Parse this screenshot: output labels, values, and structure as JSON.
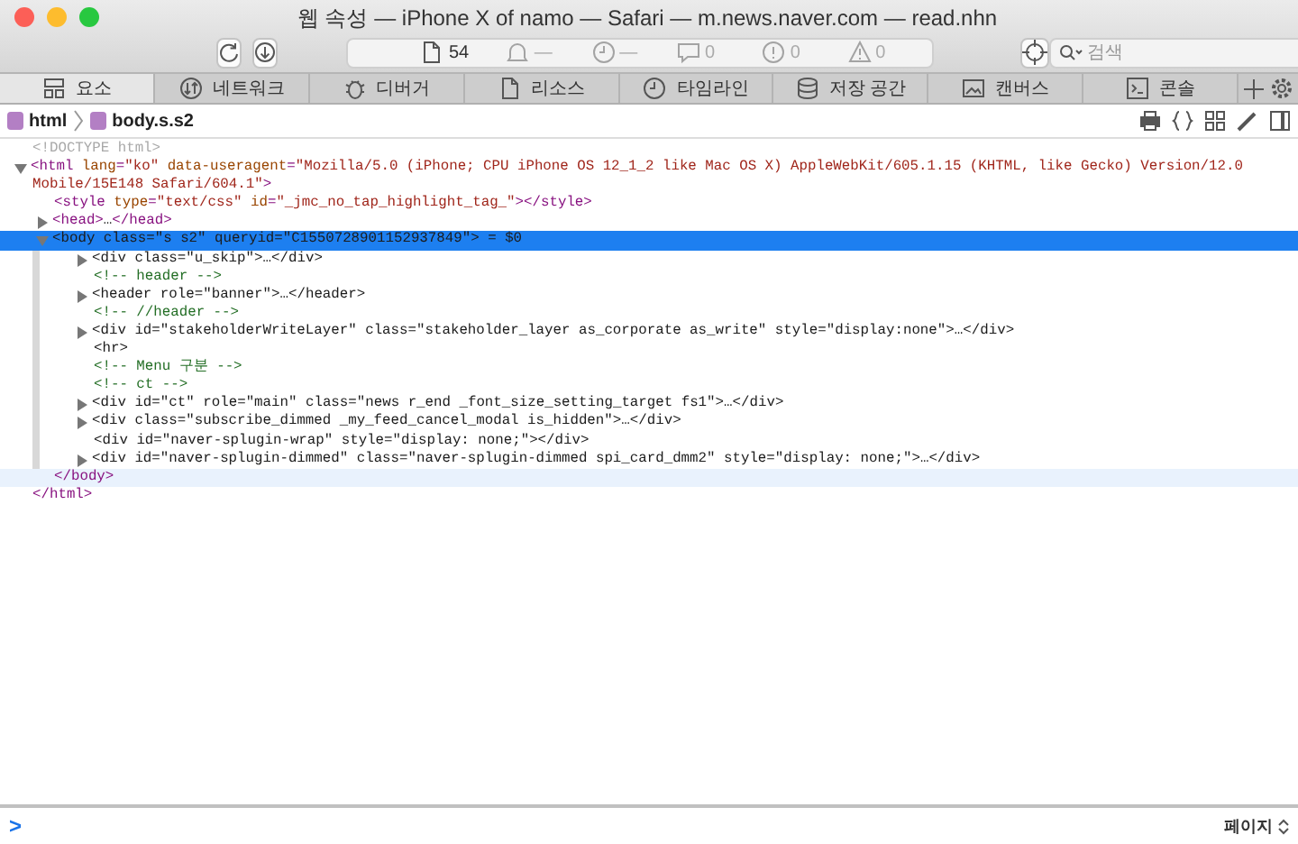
{
  "window": {
    "title": "웹 속성 — iPhone X of namo — Safari — m.news.naver.com — read.nhn"
  },
  "toolbar": {
    "activity": [
      {
        "kind": "resources",
        "value": "54"
      },
      {
        "kind": "bell",
        "value": "—"
      },
      {
        "kind": "clock",
        "value": "—"
      },
      {
        "kind": "logs",
        "value": "0"
      },
      {
        "kind": "errors",
        "value": "0"
      },
      {
        "kind": "warnings",
        "value": "0"
      }
    ],
    "search": {
      "placeholder": "검색"
    }
  },
  "tabs": [
    {
      "label": "요소",
      "selected": true
    },
    {
      "label": "네트워크",
      "selected": false
    },
    {
      "label": "디버거",
      "selected": false
    },
    {
      "label": "리소스",
      "selected": false
    },
    {
      "label": "타임라인",
      "selected": false
    },
    {
      "label": "저장 공간",
      "selected": false
    },
    {
      "label": "캔버스",
      "selected": false
    },
    {
      "label": "콘솔",
      "selected": false
    }
  ],
  "breadcrumb": [
    {
      "label": "html"
    },
    {
      "label": "body.s.s2"
    }
  ],
  "dom_tree": [
    {
      "kind": "leaf",
      "selected": false,
      "tokens": [
        {
          "kind": "doctype",
          "text": "<!DOCTYPE html>"
        }
      ]
    },
    {
      "kind": "container",
      "expanded": true,
      "selected": false,
      "tokens": [
        {
          "kind": "tag",
          "text": "<html"
        },
        {
          "kind": "attribute",
          "text": " lang"
        },
        {
          "kind": "tag",
          "text": "="
        },
        {
          "kind": "value",
          "text": "\"ko\""
        },
        {
          "kind": "attribute",
          "text": " data-useragent"
        },
        {
          "kind": "tag",
          "text": "="
        },
        {
          "kind": "value",
          "text": "\"Mozilla/5.0 (iPhone; CPU iPhone OS 12_1_2 like Mac OS X) AppleWebKit/605.1.15 (KHTML, like Gecko) Version/12.0 Mobile/15E148 Safari/604.1\""
        },
        {
          "kind": "tag",
          "text": ">"
        }
      ],
      "closing": [
        {
          "kind": "tag",
          "text": "</html>"
        }
      ],
      "children": [
        {
          "kind": "leaf",
          "selected": false,
          "tokens": [
            {
              "kind": "tag",
              "text": "<style"
            },
            {
              "kind": "attribute",
              "text": " type"
            },
            {
              "kind": "tag",
              "text": "="
            },
            {
              "kind": "value",
              "text": "\"text/css\""
            },
            {
              "kind": "attribute",
              "text": " id"
            },
            {
              "kind": "tag",
              "text": "="
            },
            {
              "kind": "value",
              "text": "\"_jmc_no_tap_highlight_tag_\""
            },
            {
              "kind": "tag",
              "text": "></style>"
            }
          ]
        },
        {
          "kind": "container",
          "expanded": false,
          "selected": false,
          "tokens": [
            {
              "kind": "tag",
              "text": "<head>"
            },
            {
              "kind": "text",
              "text": "…"
            },
            {
              "kind": "tag",
              "text": "</head>"
            }
          ]
        },
        {
          "kind": "container",
          "expanded": true,
          "selected": true,
          "tokens": [
            {
              "kind": "tag",
              "text": "<body"
            },
            {
              "kind": "attribute",
              "text": " class"
            },
            {
              "kind": "tag",
              "text": "="
            },
            {
              "kind": "value",
              "text": "\"s s2\""
            },
            {
              "kind": "attribute",
              "text": " queryid"
            },
            {
              "kind": "tag",
              "text": "="
            },
            {
              "kind": "value",
              "text": "\"C1550728901152937849\""
            },
            {
              "kind": "tag",
              "text": ">"
            },
            {
              "kind": "text",
              "text": " = $0"
            }
          ],
          "closing": [
            {
              "kind": "tag",
              "text": "</body>"
            }
          ],
          "children": [
            {
              "kind": "container",
              "expanded": false,
              "selected": false,
              "tokens": [
                {
                  "kind": "tag",
                  "text": "<div"
                },
                {
                  "kind": "attribute",
                  "text": " class"
                },
                {
                  "kind": "tag",
                  "text": "="
                },
                {
                  "kind": "value",
                  "text": "\"u_skip\""
                },
                {
                  "kind": "tag",
                  "text": ">"
                },
                {
                  "kind": "text",
                  "text": "…"
                },
                {
                  "kind": "tag",
                  "text": "</div>"
                }
              ]
            },
            {
              "kind": "leaf",
              "selected": false,
              "tokens": [
                {
                  "kind": "comment",
                  "text": "<!-- header -->"
                }
              ]
            },
            {
              "kind": "container",
              "expanded": false,
              "selected": false,
              "tokens": [
                {
                  "kind": "tag",
                  "text": "<header"
                },
                {
                  "kind": "attribute",
                  "text": " role"
                },
                {
                  "kind": "tag",
                  "text": "="
                },
                {
                  "kind": "value",
                  "text": "\"banner\""
                },
                {
                  "kind": "tag",
                  "text": ">"
                },
                {
                  "kind": "text",
                  "text": "…"
                },
                {
                  "kind": "tag",
                  "text": "</header>"
                }
              ]
            },
            {
              "kind": "leaf",
              "selected": false,
              "tokens": [
                {
                  "kind": "comment",
                  "text": "<!-- //header -->"
                }
              ]
            },
            {
              "kind": "container",
              "expanded": false,
              "selected": false,
              "tokens": [
                {
                  "kind": "tag",
                  "text": "<div"
                },
                {
                  "kind": "attribute",
                  "text": " id"
                },
                {
                  "kind": "tag",
                  "text": "="
                },
                {
                  "kind": "value",
                  "text": "\"stakeholderWriteLayer\""
                },
                {
                  "kind": "attribute",
                  "text": " class"
                },
                {
                  "kind": "tag",
                  "text": "="
                },
                {
                  "kind": "value",
                  "text": "\"stakeholder_layer as_corporate as_write\""
                },
                {
                  "kind": "attribute",
                  "text": " style"
                },
                {
                  "kind": "tag",
                  "text": "="
                },
                {
                  "kind": "value",
                  "text": "\"display:none\""
                },
                {
                  "kind": "tag",
                  "text": ">"
                },
                {
                  "kind": "text",
                  "text": "…"
                },
                {
                  "kind": "tag",
                  "text": "</div>"
                }
              ]
            },
            {
              "kind": "leaf",
              "selected": false,
              "tokens": [
                {
                  "kind": "tag",
                  "text": "<hr>"
                }
              ]
            },
            {
              "kind": "leaf",
              "selected": false,
              "tokens": [
                {
                  "kind": "comment",
                  "text": "<!-- Menu 구분 -->"
                }
              ]
            },
            {
              "kind": "leaf",
              "selected": false,
              "tokens": [
                {
                  "kind": "comment",
                  "text": "<!-- ct -->"
                }
              ]
            },
            {
              "kind": "container",
              "expanded": false,
              "selected": false,
              "tokens": [
                {
                  "kind": "tag",
                  "text": "<div"
                },
                {
                  "kind": "attribute",
                  "text": " id"
                },
                {
                  "kind": "tag",
                  "text": "="
                },
                {
                  "kind": "value",
                  "text": "\"ct\""
                },
                {
                  "kind": "attribute",
                  "text": " role"
                },
                {
                  "kind": "tag",
                  "text": "="
                },
                {
                  "kind": "value",
                  "text": "\"main\""
                },
                {
                  "kind": "attribute",
                  "text": " class"
                },
                {
                  "kind": "tag",
                  "text": "="
                },
                {
                  "kind": "value",
                  "text": "\"news r_end _font_size_setting_target fs1\""
                },
                {
                  "kind": "tag",
                  "text": ">"
                },
                {
                  "kind": "text",
                  "text": "…"
                },
                {
                  "kind": "tag",
                  "text": "</div>"
                }
              ]
            },
            {
              "kind": "container",
              "expanded": false,
              "selected": false,
              "tokens": [
                {
                  "kind": "tag",
                  "text": "<div"
                },
                {
                  "kind": "attribute",
                  "text": " class"
                },
                {
                  "kind": "tag",
                  "text": "="
                },
                {
                  "kind": "value",
                  "text": "\"subscribe_dimmed _my_feed_cancel_modal is_hidden\""
                },
                {
                  "kind": "tag",
                  "text": ">"
                },
                {
                  "kind": "text",
                  "text": "…"
                },
                {
                  "kind": "tag",
                  "text": "</div>"
                }
              ]
            },
            {
              "kind": "leaf",
              "selected": false,
              "tokens": [
                {
                  "kind": "tag",
                  "text": "<div"
                },
                {
                  "kind": "attribute",
                  "text": " id"
                },
                {
                  "kind": "tag",
                  "text": "="
                },
                {
                  "kind": "value",
                  "text": "\"naver-splugin-wrap\""
                },
                {
                  "kind": "attribute",
                  "text": " style"
                },
                {
                  "kind": "tag",
                  "text": "="
                },
                {
                  "kind": "value",
                  "text": "\"display: none;\""
                },
                {
                  "kind": "tag",
                  "text": "></div>"
                }
              ]
            },
            {
              "kind": "container",
              "expanded": false,
              "selected": false,
              "tokens": [
                {
                  "kind": "tag",
                  "text": "<div"
                },
                {
                  "kind": "attribute",
                  "text": " id"
                },
                {
                  "kind": "tag",
                  "text": "="
                },
                {
                  "kind": "value",
                  "text": "\"naver-splugin-dimmed\""
                },
                {
                  "kind": "attribute",
                  "text": " class"
                },
                {
                  "kind": "tag",
                  "text": "="
                },
                {
                  "kind": "value",
                  "text": "\"naver-splugin-dimmed spi_card_dmm2\""
                },
                {
                  "kind": "attribute",
                  "text": " style"
                },
                {
                  "kind": "tag",
                  "text": "="
                },
                {
                  "kind": "value",
                  "text": "\"display: none;\""
                },
                {
                  "kind": "tag",
                  "text": ">"
                },
                {
                  "kind": "text",
                  "text": "…"
                },
                {
                  "kind": "tag",
                  "text": "</div>"
                }
              ]
            }
          ]
        }
      ]
    }
  ],
  "console": {
    "prompt": ">",
    "context": "페이지"
  }
}
